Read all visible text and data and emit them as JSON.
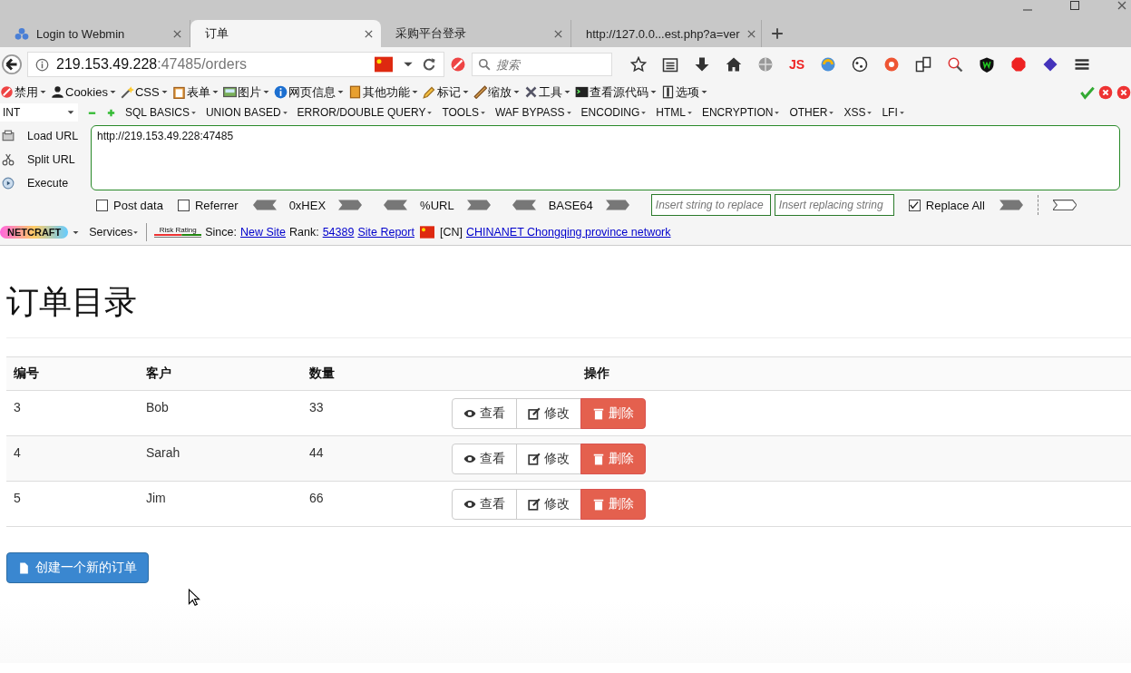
{
  "tabs": [
    {
      "title": "Login to Webmin",
      "selected": false,
      "icon": true
    },
    {
      "title": "订单",
      "selected": true,
      "icon": false
    },
    {
      "title": "采购平台登录",
      "selected": false,
      "icon": false
    },
    {
      "title": "http://127.0.0...est.php?a=ver",
      "selected": false,
      "icon": false
    }
  ],
  "address": {
    "host": "219.153.49.228",
    "rest": ":47485/orders"
  },
  "search": {
    "placeholder": "搜索"
  },
  "js_button": "JS",
  "addon_bar": [
    "禁用",
    "Cookies",
    "CSS",
    "表单",
    "图片",
    "网页信息",
    "其他功能",
    "标记",
    "缩放",
    "工具",
    "查看源代码",
    "选项"
  ],
  "hackbar": {
    "select": "INT",
    "menus": [
      "SQL BASICS",
      "UNION BASED",
      "ERROR/DOUBLE QUERY",
      "TOOLS",
      "WAF BYPASS",
      "ENCODING",
      "HTML",
      "ENCRYPTION",
      "OTHER",
      "XSS",
      "LFI"
    ],
    "actions": [
      "Load URL",
      "Split URL",
      "Execute"
    ],
    "url": "http://219.153.49.228:47485",
    "options": [
      {
        "label": "Post data",
        "checked": false
      },
      {
        "label": "Referrer",
        "checked": false
      }
    ],
    "encoders": [
      "0xHEX",
      "%URL",
      "BASE64"
    ],
    "replace_placeholder": "Insert string to replace",
    "replacing_placeholder": "Insert replacing string",
    "replace_all": {
      "label": "Replace All",
      "checked": true
    }
  },
  "netcraft": {
    "logo": "NETCRAFT",
    "services": "Services",
    "risk": "Risk Rating",
    "since": "Since:",
    "site": "New Site",
    "rank_label": "Rank:",
    "rank": "54389",
    "report": "Site Report",
    "country": "[CN]",
    "network": "CHINANET Chongqing province network"
  },
  "page": {
    "heading": "订单目录",
    "columns": [
      "编号",
      "客户",
      "数量",
      "操作"
    ],
    "rows": [
      {
        "cells": [
          "3",
          "Bob",
          "33"
        ],
        "actions": [
          {
            "label": "查看",
            "kind": "view"
          },
          {
            "label": "修改",
            "kind": "edit"
          },
          {
            "label": "删除",
            "kind": "delete"
          }
        ]
      },
      {
        "cells": [
          "4",
          "Sarah",
          "44"
        ],
        "actions": [
          {
            "label": "查看",
            "kind": "view"
          },
          {
            "label": "修改",
            "kind": "edit"
          },
          {
            "label": "删除",
            "kind": "delete"
          }
        ]
      },
      {
        "cells": [
          "5",
          "Jim",
          "66"
        ],
        "actions": [
          {
            "label": "查看",
            "kind": "view"
          },
          {
            "label": "修改",
            "kind": "edit"
          },
          {
            "label": "删除",
            "kind": "delete"
          }
        ]
      }
    ],
    "create_button": "创建一个新的订单"
  }
}
